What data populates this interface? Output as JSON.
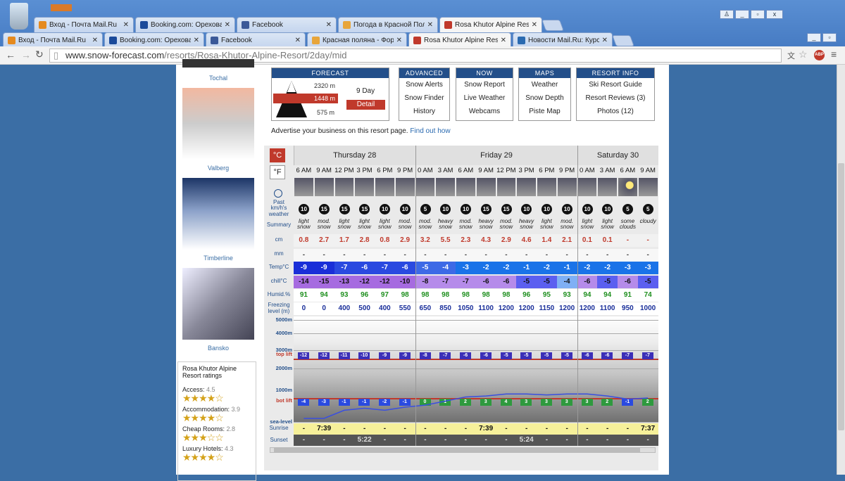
{
  "browser": {
    "tabs_row1": [
      {
        "title": "Вход - Почта Mail.Ru",
        "icon": "mailru-icon",
        "color": "#e58a1f"
      },
      {
        "title": "Booking.com: Ореховая Рощ",
        "icon": "booking-icon",
        "color": "#1b4a9a"
      },
      {
        "title": "Facebook",
        "icon": "facebook-icon",
        "color": "#3b5998"
      },
      {
        "title": "Погода в Красной Поляне -",
        "icon": "weather-icon",
        "color": "#e8a53a"
      },
      {
        "title": "Rosa Khutor Alpine Resort De",
        "icon": "snowforecast-icon",
        "color": "#c0392b"
      }
    ],
    "tabs_row2": [
      {
        "title": "Вход - Почта Mail.Ru",
        "icon": "mailru-icon",
        "color": "#e58a1f"
      },
      {
        "title": "Booking.com: Ореховая Рош",
        "icon": "booking-icon",
        "color": "#1b4a9a"
      },
      {
        "title": "Facebook",
        "icon": "facebook-icon",
        "color": "#3b5998"
      },
      {
        "title": "Красная поляна - Форум Sk",
        "icon": "forum-icon",
        "color": "#e8a53a"
      },
      {
        "title": "Rosa Khutor Alpine Resort De",
        "icon": "snowforecast-icon",
        "color": "#c0392b"
      },
      {
        "title": "Новости Mail.Ru: Курсы ва",
        "icon": "news-icon",
        "color": "#2a6ab0"
      }
    ],
    "url_host": "www.snow-forecast.com",
    "url_path": "/resorts/Rosa-Khutor-Alpine-Resort/2day/mid"
  },
  "sidebar": {
    "resorts": [
      "Tochal",
      "Valberg",
      "Timberline",
      "Bansko"
    ],
    "ratings_title": "Rosa Khutor Alpine Resort ratings",
    "ratings": [
      {
        "label": "Access:",
        "value": "4.5",
        "stars": "★★★★☆"
      },
      {
        "label": "Accommodation:",
        "value": "3.9",
        "stars": "★★★★☆"
      },
      {
        "label": "Cheap Rooms:",
        "value": "2.8",
        "stars": "★★★☆☆"
      },
      {
        "label": "Luxury Hotels:",
        "value": "4.3",
        "stars": "★★★★☆"
      }
    ]
  },
  "nav": {
    "forecast": {
      "header": "FORECAST",
      "top": "2320 m",
      "mid": "1448 m",
      "bot": "575 m",
      "days": "9 Day",
      "detail": "Detail"
    },
    "advanced": {
      "header": "ADVANCED",
      "items": [
        "Snow Alerts",
        "Snow Finder",
        "History"
      ]
    },
    "now": {
      "header": "NOW",
      "items": [
        "Snow Report",
        "Live Weather",
        "Webcams"
      ]
    },
    "maps": {
      "header": "MAPS",
      "items": [
        "Weather",
        "Snow Depth",
        "Piste Map"
      ]
    },
    "info": {
      "header": "RESORT INFO",
      "items": [
        "Ski Resort Guide",
        "Resort Reviews (3)",
        "Photos (12)"
      ]
    }
  },
  "advert": {
    "text": "Advertise your business on this resort page.",
    "link": "Find out how"
  },
  "forecast": {
    "unit_c": "°C",
    "unit_f": "°F",
    "days": [
      {
        "name": "Thursday 28",
        "cols": 6
      },
      {
        "name": "Friday 29",
        "cols": 8
      },
      {
        "name": "Saturday 30",
        "cols": 4
      }
    ],
    "hours": [
      "6 AM",
      "9 AM",
      "12 PM",
      "3 PM",
      "6 PM",
      "9 PM",
      "0 AM",
      "3 AM",
      "6 AM",
      "9 AM",
      "12 PM",
      "3 PM",
      "6 PM",
      "9 PM",
      "0 AM",
      "3 AM",
      "6 AM",
      "9 AM"
    ],
    "row_labels": {
      "past": "Past",
      "wind": "km/h's weather",
      "summary": "Summary",
      "snow": "cm",
      "rain": "mm",
      "temp": "Temp°C",
      "chill": "chill°C",
      "humid": "Humid.%",
      "freezing": "Freezing level (m)",
      "sunrise": "Sunrise",
      "sunset": "Sunset"
    },
    "wind": [
      10,
      15,
      15,
      15,
      10,
      10,
      5,
      10,
      10,
      15,
      15,
      10,
      10,
      10,
      10,
      10,
      5,
      5
    ],
    "summary": [
      "light snow",
      "mod. snow",
      "light snow",
      "light snow",
      "light snow",
      "mod. snow",
      "mod. snow",
      "heavy snow",
      "mod. snow",
      "heavy snow",
      "mod. snow",
      "heavy snow",
      "light snow",
      "mod. snow",
      "light snow",
      "light snow",
      "some clouds",
      "cloudy"
    ],
    "snow": [
      "0.8",
      "2.7",
      "1.7",
      "2.8",
      "0.8",
      "2.9",
      "3.2",
      "5.5",
      "2.3",
      "4.3",
      "2.9",
      "4.6",
      "1.4",
      "2.1",
      "0.1",
      "0.1",
      "-",
      "-"
    ],
    "rain": [
      "-",
      "-",
      "-",
      "-",
      "-",
      "-",
      "-",
      "-",
      "-",
      "-",
      "-",
      "-",
      "-",
      "-",
      "-",
      "-",
      "-",
      "-"
    ],
    "temp": [
      -9,
      -9,
      -7,
      -6,
      -7,
      -6,
      -5,
      -4,
      -3,
      -2,
      -2,
      -1,
      -2,
      -1,
      -2,
      -2,
      -3,
      -3
    ],
    "chill": [
      -14,
      -15,
      -13,
      -12,
      -12,
      -10,
      -8,
      -7,
      -7,
      -6,
      -6,
      -5,
      -5,
      -4,
      -6,
      -5,
      -6,
      -5
    ],
    "humid": [
      91,
      94,
      93,
      96,
      97,
      98,
      98,
      98,
      98,
      98,
      98,
      96,
      95,
      93,
      94,
      94,
      91,
      74
    ],
    "freezing": [
      0,
      0,
      400,
      500,
      400,
      550,
      650,
      850,
      1050,
      1100,
      1200,
      1200,
      1150,
      1200,
      1200,
      1100,
      950,
      1000
    ],
    "altitudes": [
      "5000m",
      "4000m",
      "3000m",
      "2000m",
      "1000m",
      "sea-level"
    ],
    "top_lift": "top lift",
    "bot_lift": "bot lift",
    "top_lift_temps": [
      -12,
      -12,
      -11,
      -10,
      -9,
      -9,
      -8,
      -7,
      -6,
      -6,
      -5,
      -5,
      -5,
      -5,
      -6,
      -6,
      -7,
      -7
    ],
    "bot_lift_temps": [
      -4,
      -3,
      -1,
      -1,
      -2,
      -1,
      0,
      1,
      2,
      3,
      4,
      3,
      3,
      3,
      3,
      2,
      -1,
      2
    ],
    "sunrise": [
      "-",
      "7:39",
      "-",
      "-",
      "-",
      "-",
      "-",
      "-",
      "-",
      "7:39",
      "-",
      "-",
      "-",
      "-",
      "-",
      "-",
      "-",
      "7:37"
    ],
    "sunset": [
      "-",
      "-",
      "-",
      "5:22",
      "-",
      "-",
      "-",
      "-",
      "-",
      "-",
      "-",
      "5:24",
      "-",
      "-",
      "-",
      "-",
      "-",
      "-"
    ]
  }
}
